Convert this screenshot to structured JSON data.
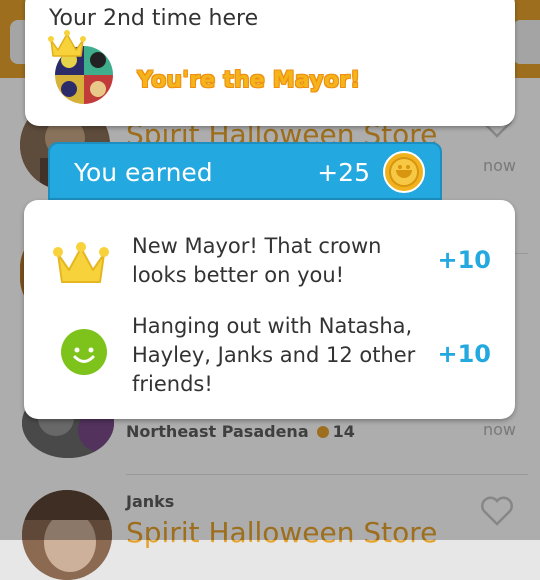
{
  "feed": {
    "items": [
      {
        "venue": "Spirit Halloween Store",
        "time": "now"
      },
      {
        "venue": "Northeast Pasadena",
        "coins": "14",
        "time": "now"
      },
      {
        "user": "Janks",
        "venue": "Spirit Halloween Store"
      }
    ]
  },
  "mayor_card": {
    "visit_text": "Your 2nd time here",
    "mayor_text": "You're the Mayor!"
  },
  "earned": {
    "label": "You earned",
    "points": "+25"
  },
  "rewards": [
    {
      "text": "New Mayor! That crown looks better on you!",
      "points": "+10",
      "icon": "crown-icon"
    },
    {
      "text": "Hanging out with Natasha, Hayley, Janks and 12 other friends!",
      "points": "+10",
      "icon": "smiley-icon"
    }
  ],
  "colors": {
    "accent_orange": "#e6a32b",
    "accent_blue": "#23a8e0",
    "crown_yellow": "#f7d23a",
    "smiley_green": "#7dc31b"
  }
}
